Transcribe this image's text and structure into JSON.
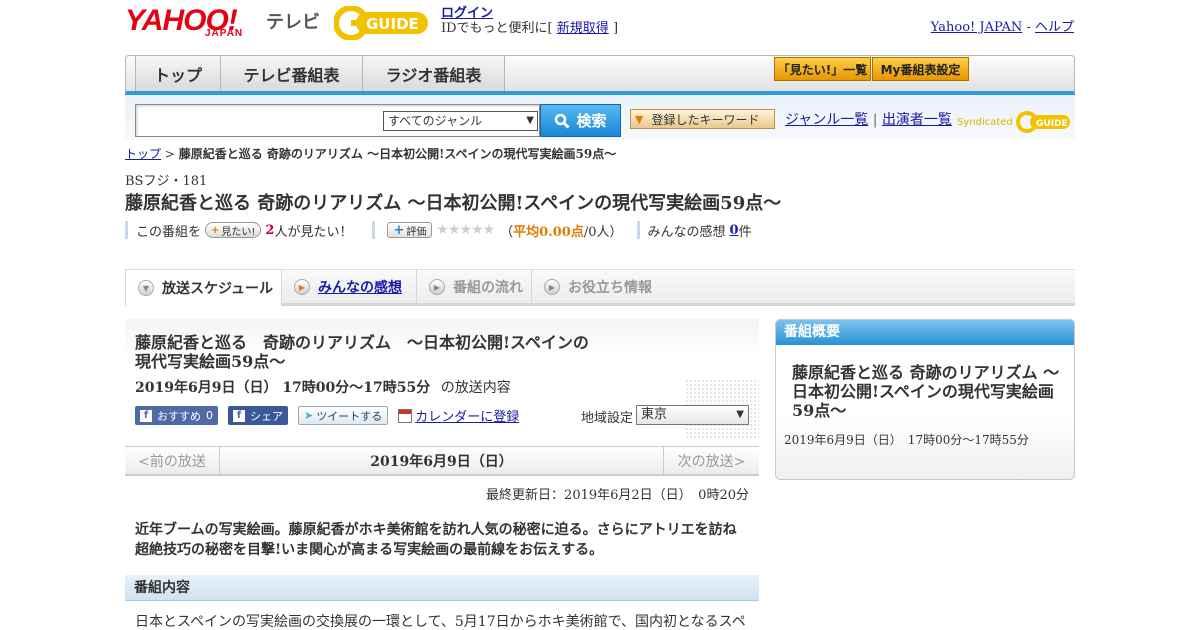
{
  "header": {
    "logo_yahoo": "YAHOO!",
    "logo_japan": "JAPAN",
    "logo_tv": "テレビ",
    "logo_gguide": "GUIDE",
    "login": "ログイン",
    "id_note_prefix": "IDでもっと便利に[",
    "signup": "新規取得",
    "id_note_suffix": "]",
    "yahoo_japan_link": "Yahoo! JAPAN",
    "sep": "-",
    "help_link": "ヘルプ"
  },
  "nav": {
    "tabs": [
      {
        "label": "トップ"
      },
      {
        "label": "テレビ番組表"
      },
      {
        "label": "ラジオ番組表"
      }
    ],
    "watchlist_button": "「見たい!」一覧",
    "my_schedule_button": "My番組表設定"
  },
  "search": {
    "placeholder": "",
    "genre_selected": "すべてのジャンル",
    "button": "検索",
    "keyword_button": "登録したキーワード",
    "genre_list_link": "ジャンル一覧",
    "link_sep": "|",
    "performer_list_link": "出演者一覧",
    "syndicated": "Syndicated"
  },
  "breadcrumb": {
    "home": "トップ",
    "sep": ">",
    "current": "藤原紀香と巡る 奇跡のリアリズム ～日本初公開!スペインの現代写実絵画59点～"
  },
  "program": {
    "channel": "BSフジ・181",
    "title": "藤原紀香と巡る 奇跡のリアリズム ～日本初公開!スペインの現代写実絵画59点～",
    "stats": {
      "this_program": "この番組を",
      "want_button": "見たい!",
      "want_count": "2",
      "want_suffix": "人が見たい！",
      "rate_button": "評価",
      "stars": "★★★★★",
      "avg_prefix": "（",
      "avg_value": "平均0.00点",
      "avg_suffix": "/0人）",
      "impressions_label": "みんなの感想",
      "impressions_count": "0",
      "impressions_suffix": "件"
    }
  },
  "subtabs": [
    {
      "label": "放送スケジュール"
    },
    {
      "label": "みんなの感想"
    },
    {
      "label": "番組の流れ"
    },
    {
      "label": "お役立ち情報"
    }
  ],
  "detail": {
    "title_line1": "藤原紀香と巡る　奇跡のリアリズム　～日本初公開!スペインの",
    "title_line2": "現代写実絵画59点～",
    "datetime": "2019年6月9日（日） 17時00分～17時55分",
    "datetime_suffix": "の放送内容",
    "fb_recommend": "おすすめ",
    "fb_count": "0",
    "fb_share": "シェア",
    "tweet": "ツイートする",
    "calendar": "カレンダーに登録",
    "area_label": "地域設定",
    "area_selected": "東京",
    "prev": "<前の放送",
    "current_date": "2019年6月9日（日）",
    "next": "次の放送>",
    "updated": "最終更新日：2019年6月2日（日）　0時20分",
    "summary": "近年ブームの写実絵画。藤原紀香がホキ美術館を訪れ人気の秘密に迫る。さらにアトリエを訪ね超絶技巧の秘密を目撃!いま関心が高まる写実絵画の最前線をお伝えする。",
    "content_heading": "番組内容",
    "content_body": "日本とスペインの写実絵画の交換展の一環として、5月17日からホキ美術館で、国内初となるスペ"
  },
  "sidebar": {
    "heading": "番組概要",
    "title": "藤原紀香と巡る 奇跡のリアリズム ～日本初公開!スペインの現代写実絵画59点～",
    "date": "2019年6月9日（日）　17時00分～17時55分"
  },
  "colors": {
    "accent_blue": "#2d9be0",
    "yahoo_red": "#e60012",
    "gguide_yellow": "#f2c200",
    "orange": "#e07a00"
  }
}
